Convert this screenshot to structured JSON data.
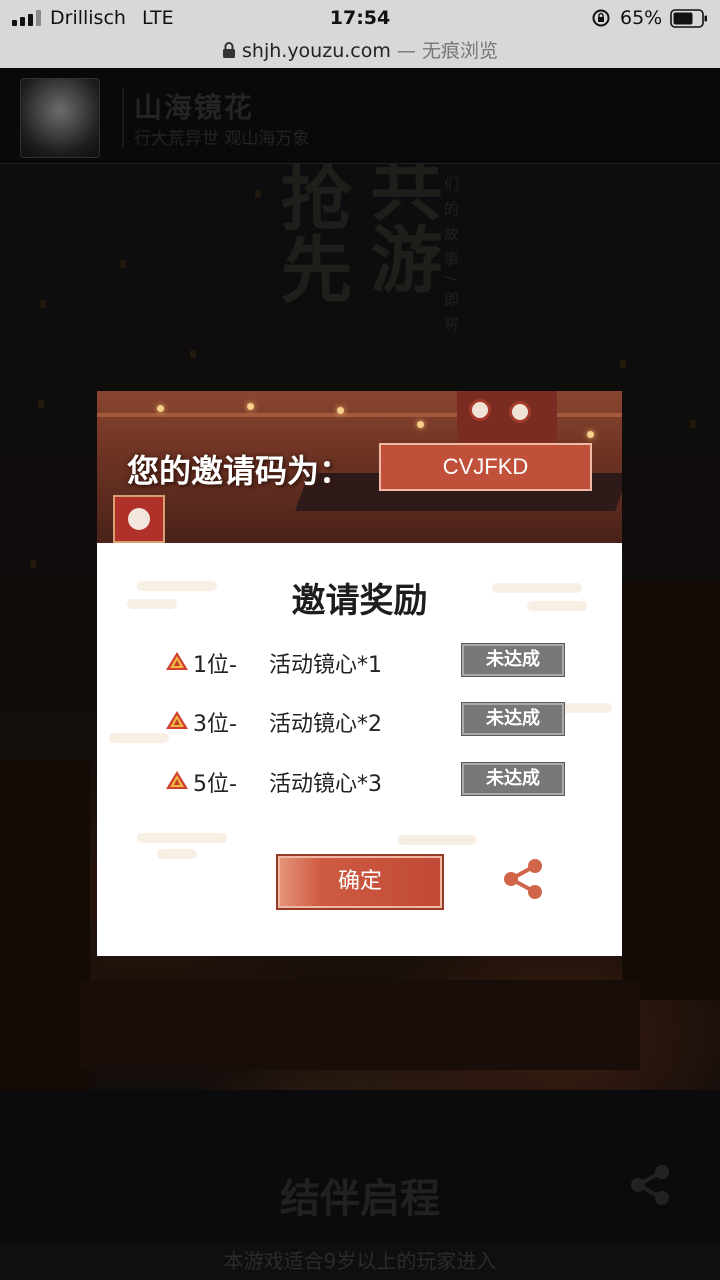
{
  "status_bar": {
    "carrier": "Drillisch",
    "network": "LTE",
    "time": "17:54",
    "battery_percent": "65%"
  },
  "url_bar": {
    "domain": "shjh.youzu.com",
    "mode": " — 无痕浏览"
  },
  "site_header": {
    "title": "山海镜花",
    "slogan": "行大荒异世 观山海万象"
  },
  "background": {
    "calligraphy_left": "抢先",
    "calligraphy_right": "共游",
    "vertical_text": "们的故事/即将",
    "bottom_title": "结伴启程",
    "age_notice": "本游戏适合9岁以上的玩家进入"
  },
  "modal": {
    "code_label": "您的邀请码为：",
    "invite_code": "CVJFKD",
    "rewards_title": "邀请奖励",
    "rewards": [
      {
        "rank": "1位-",
        "item": "活动镜心*1",
        "status": "未达成"
      },
      {
        "rank": "3位-",
        "item": "活动镜心*2",
        "status": "未达成"
      },
      {
        "rank": "5位-",
        "item": "活动镜心*3",
        "status": "未达成"
      }
    ],
    "confirm_label": "确定"
  },
  "icons": {
    "share": "share-icon",
    "gem": "gem-icon",
    "lock": "lock-icon",
    "battery": "battery-icon",
    "rotation_lock": "rotation-lock-icon"
  },
  "colors": {
    "accent": "#c0503a",
    "badge_gray": "#787878"
  }
}
